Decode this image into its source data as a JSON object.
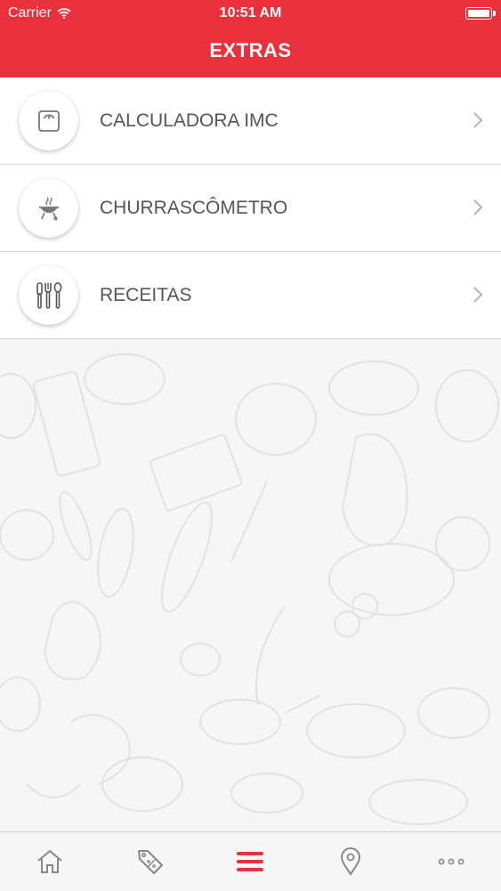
{
  "status_bar": {
    "carrier": "Carrier",
    "time": "10:51 AM"
  },
  "header": {
    "title": "EXTRAS"
  },
  "menu": {
    "items": [
      {
        "label": "CALCULADORA IMC",
        "icon": "scale-icon"
      },
      {
        "label": "CHURRASCÔMETRO",
        "icon": "grill-icon"
      },
      {
        "label": "RECEITAS",
        "icon": "cutlery-icon"
      }
    ]
  },
  "tabbar": {
    "tabs": [
      {
        "icon": "home-icon",
        "active": false
      },
      {
        "icon": "discount-tag-icon",
        "active": false
      },
      {
        "icon": "menu-icon",
        "active": true
      },
      {
        "icon": "location-pin-icon",
        "active": false
      },
      {
        "icon": "more-icon",
        "active": false
      }
    ]
  },
  "colors": {
    "brand": "#e8313c",
    "label": "#555555",
    "icon": "#777777",
    "separator": "#d4d4d4"
  }
}
